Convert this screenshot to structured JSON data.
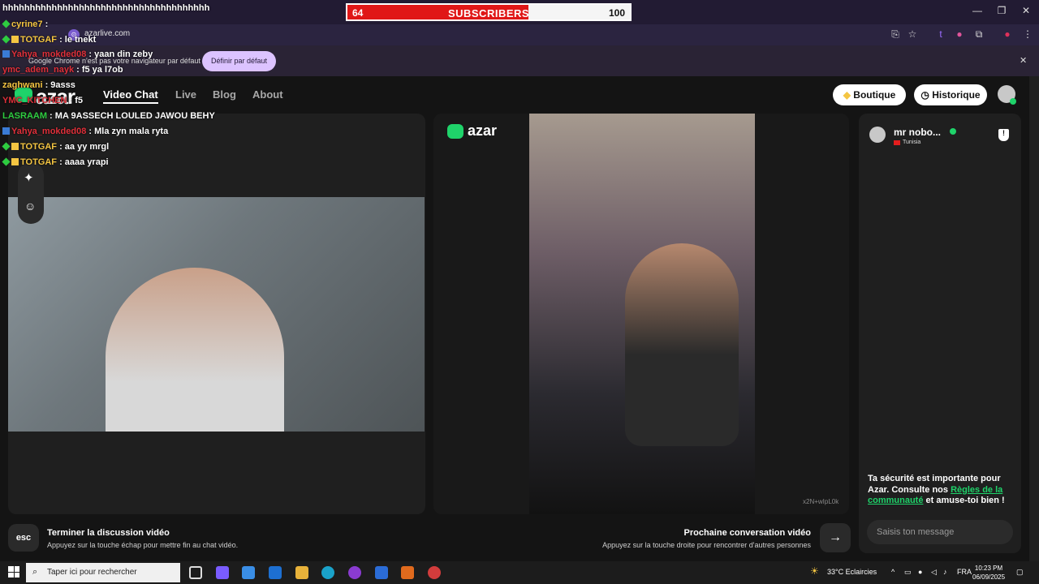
{
  "browser": {
    "url": "azarlive.com",
    "infobar_text": "Google Chrome n'est pas votre navigateur par défaut",
    "infobar_button": "Définir par défaut"
  },
  "overlay": {
    "subscribers": {
      "current": "64",
      "label": "SUBSCRIBERS",
      "goal": "100",
      "progress_fraction": 0.64
    },
    "chat_header": "hhhhhhhhhhhhhhhhhhhhhhhhhhhhhhhhhhhhhh",
    "messages": [
      {
        "user": "cyrine7",
        "text": " :",
        "user_color": "#f4c542",
        "badge": "green"
      },
      {
        "user": "TOTGAF",
        "text": " : le tnekt",
        "user_color": "#f4c542",
        "badge": "green-yellow"
      },
      {
        "user": "Yahya_mokded08",
        "text": " : yaan din zeby",
        "user_color": "#e0303a",
        "badge": "blue"
      },
      {
        "user": "ymc_adem_nayk",
        "text": " : f5 ya l7ob",
        "user_color": "#e0303a",
        "badge": ""
      },
      {
        "user": "zaghwani",
        "text": " : 9asss",
        "user_color": "#f4c542",
        "badge": ""
      },
      {
        "user": "YMC_KITCHEN",
        "text": " : f5",
        "user_color": "#e0303a",
        "badge": ""
      },
      {
        "user": "LASRAAM",
        "text": " : MA 9ASSECH LOULED JAWOU BEHY",
        "user_color": "#2ecc40",
        "badge": ""
      },
      {
        "user": "Yahya_mokded08",
        "text": " : Mla zyn mala ryta",
        "user_color": "#e0303a",
        "badge": "blue"
      },
      {
        "user": "TOTGAF",
        "text": " : aa yy mrgl",
        "user_color": "#f4c542",
        "badge": "green-yellow"
      },
      {
        "user": "TOTGAF",
        "text": " : aaaa yrapi",
        "user_color": "#f4c542",
        "badge": "green-yellow"
      }
    ]
  },
  "nav": {
    "logo": "azar",
    "items": [
      "Video Chat",
      "Live",
      "Blog",
      "About"
    ],
    "boutique": "Boutique",
    "historique": "Historique"
  },
  "video": {
    "watermark": "azar",
    "stream_id": "x2N+wIpL0k"
  },
  "chat": {
    "peer_name": "mr nobo...",
    "peer_country": "Tunisia",
    "safety_text_1": "Ta sécurité est importante pour Azar. Consulte nos ",
    "safety_link": "Règles de la communauté",
    "safety_text_2": " et amuse-toi bien !",
    "input_placeholder": "Saisis ton message"
  },
  "footer": {
    "esc_label": "esc",
    "end_title": "Terminer la discussion vidéo",
    "end_sub": "Appuyez sur la touche échap pour mettre fin au chat vidéo.",
    "next_title": "Prochaine conversation vidéo",
    "next_sub": "Appuyez sur la touche droite pour rencontrer d'autres personnes",
    "next_icon": "→"
  },
  "taskbar": {
    "search_placeholder": "Taper ici pour rechercher",
    "weather": "33°C  Eclaircies",
    "lang": "FRA",
    "time": "10:23 PM",
    "date": "06/09/2025"
  },
  "colors": {
    "accent": "#1fd36a",
    "subscriber_fill": "#e01717",
    "infobar_button": "#dcc3ff"
  }
}
